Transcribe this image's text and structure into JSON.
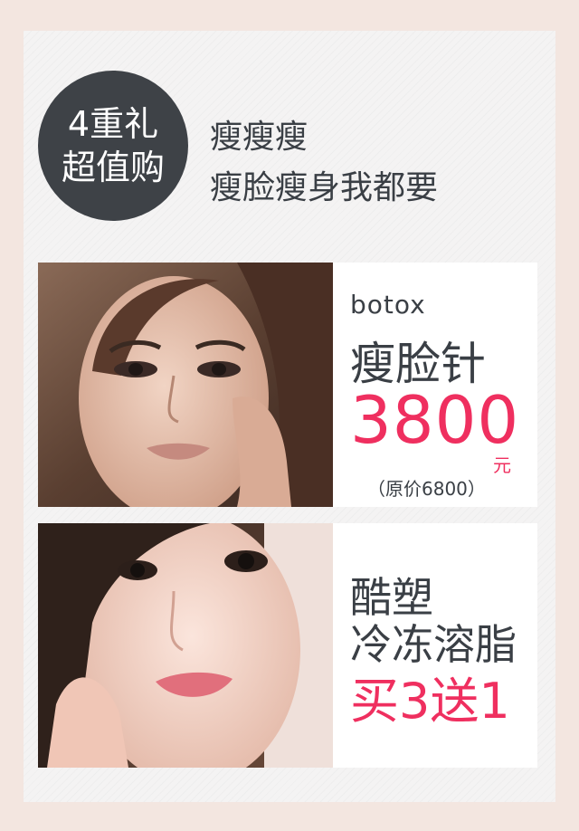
{
  "badge": {
    "line1": "4重礼",
    "line2": "超值购"
  },
  "headline": {
    "line1": "瘦瘦瘦",
    "line2": "瘦脸瘦身我都要"
  },
  "products": [
    {
      "english_name": "botox",
      "name": "瘦脸针",
      "price": "3800",
      "unit": "元",
      "original_price": "（原价6800）"
    },
    {
      "line1": "酷塑",
      "line2": "冷冻溶脂",
      "offer": "买3送1"
    }
  ],
  "colors": {
    "accent": "#ef2f5f",
    "text": "#3a3f45",
    "badge_bg": "#3e4247",
    "page_bg": "#f3e6e0"
  }
}
